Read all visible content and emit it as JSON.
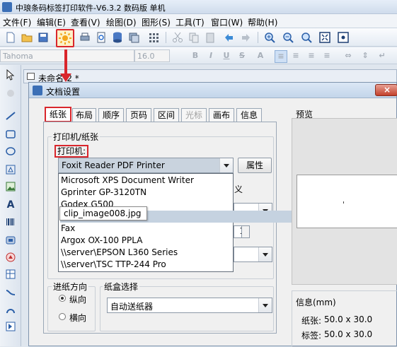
{
  "app": {
    "title": "中琅条码标签打印软件-V6.3.2 数码版 单机"
  },
  "menu": [
    "文件(F)",
    "编辑(E)",
    "查看(V)",
    "绘图(D)",
    "图形(S)",
    "工具(T)",
    "窗口(W)",
    "帮助(H)"
  ],
  "format_bar": {
    "font": "Tahoma",
    "size": "16.0"
  },
  "document": {
    "title": "未命名-2 *"
  },
  "dialog": {
    "title": "文档设置",
    "tabs": [
      "纸张",
      "布局",
      "顺序",
      "页码",
      "区间",
      "光标",
      "画布",
      "信息"
    ],
    "printer_group": "打印机/纸张",
    "printer_label": "打印机:",
    "printer_selected": "Foxit Reader PDF Printer",
    "properties_button": "属性",
    "printer_options": [
      "Microsoft XPS Document Writer",
      "Gprinter  GP-3120TN",
      "Godex G500",
      "Foxit Reader PDF Printer",
      "Fax",
      "Argox OX-100 PPLA",
      "\\\\server\\EPSON L360 Series",
      "\\\\server\\TSC TTP-244 Pro"
    ],
    "option_selected_visible": "ter",
    "tooltip": "clip_image008.jpg",
    "hidden_label_fragment": "义",
    "hidden_number": "1",
    "feed_group": "进纸方向",
    "portrait": "纵向",
    "landscape": "横向",
    "tray_group": "纸盒选择",
    "tray_selected": "自动送纸器",
    "preview_label": "预览",
    "info_label": "信息(mm)",
    "paper_label": "纸张:",
    "paper_value": "50.0 x 30.0",
    "label_label": "标签:",
    "label_value": "50.0 x 30.0"
  },
  "colors": {
    "highlight_red": "#d9262c",
    "selection_blue": "#3399ff"
  }
}
